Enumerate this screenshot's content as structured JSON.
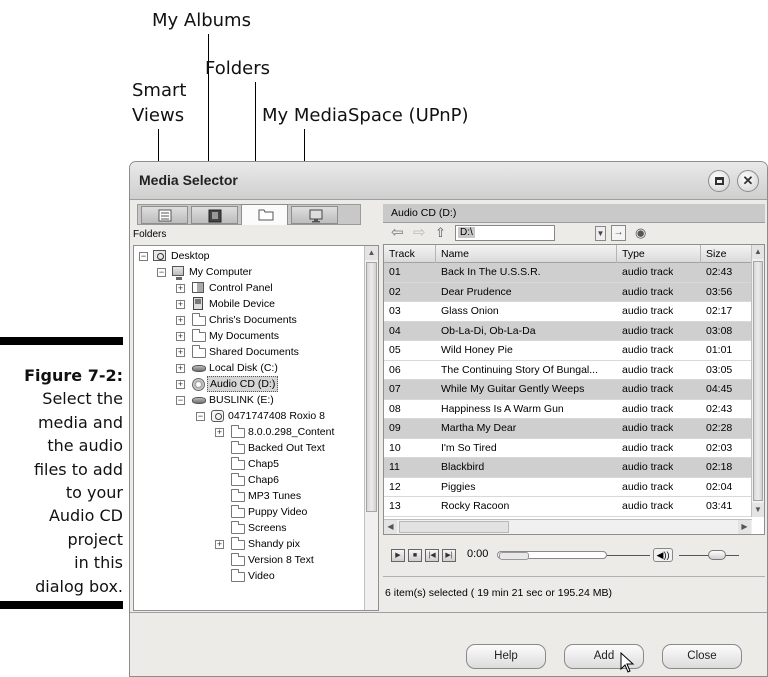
{
  "callouts": {
    "my_albums": "My Albums",
    "folders": "Folders",
    "smart_views_1": "Smart",
    "smart_views_2": "Views",
    "media_space": "My MediaSpace (UPnP)"
  },
  "figure": {
    "label": "Figure 7-2:",
    "lines": [
      "Select the",
      "media and",
      "the audio",
      "files to add",
      "to your",
      "Audio CD",
      "project",
      "in this",
      "dialog box."
    ]
  },
  "dialog": {
    "title": "Media Selector",
    "tabs": [
      "smart-views-icon",
      "my-albums-icon",
      "folders-icon",
      "my-mediaspace-icon"
    ],
    "tree_label": "Folders",
    "tree": {
      "desktop": "Desktop",
      "my_computer": "My Computer",
      "control_panel": "Control Panel",
      "mobile_device": "Mobile Device",
      "chris_docs": "Chris's Documents",
      "my_docs": "My Documents",
      "shared_docs": "Shared Documents",
      "local_disk": "Local Disk (C:)",
      "audio_cd": "Audio CD (D:)",
      "buslink": "BUSLINK (E:)",
      "roxio": "0471747408 Roxio 8",
      "content": "8.0.0.298_Content",
      "backed_out": "Backed Out Text",
      "chap5": "Chap5",
      "chap6": "Chap6",
      "mp3": "MP3 Tunes",
      "puppy": "Puppy Video",
      "screens": "Screens",
      "shandy": "Shandy pix",
      "version8": "Version 8 Text",
      "video": "Video"
    },
    "right_header": "Audio CD (D:)",
    "path_value": "D:\\",
    "columns": {
      "track": "Track",
      "name": "Name",
      "type": "Type",
      "size": "Size"
    },
    "rows": [
      {
        "track": "01",
        "name": "Back In The U.S.S.R.",
        "type": "audio track",
        "size": "02:43"
      },
      {
        "track": "02",
        "name": "Dear Prudence",
        "type": "audio track",
        "size": "03:56"
      },
      {
        "track": "03",
        "name": "Glass Onion",
        "type": "audio track",
        "size": "02:17"
      },
      {
        "track": "04",
        "name": "Ob-La-Di, Ob-La-Da",
        "type": "audio track",
        "size": "03:08"
      },
      {
        "track": "05",
        "name": "Wild Honey Pie",
        "type": "audio track",
        "size": "01:01"
      },
      {
        "track": "06",
        "name": "The Continuing Story Of Bungal...",
        "type": "audio track",
        "size": "03:05"
      },
      {
        "track": "07",
        "name": "While My Guitar Gently Weeps",
        "type": "audio track",
        "size": "04:45"
      },
      {
        "track": "08",
        "name": "Happiness Is A Warm Gun",
        "type": "audio track",
        "size": "02:43"
      },
      {
        "track": "09",
        "name": "Martha My Dear",
        "type": "audio track",
        "size": "02:28"
      },
      {
        "track": "10",
        "name": "I'm So Tired",
        "type": "audio track",
        "size": "02:03"
      },
      {
        "track": "11",
        "name": "Blackbird",
        "type": "audio track",
        "size": "02:18"
      },
      {
        "track": "12",
        "name": "Piggies",
        "type": "audio track",
        "size": "02:04"
      },
      {
        "track": "13",
        "name": "Rocky Racoon",
        "type": "audio track",
        "size": "03:41"
      }
    ],
    "player_time": "0:00",
    "status": "6 item(s) selected  ( 19 min 21 sec or 195.24 MB)",
    "buttons": {
      "help": "Help",
      "add": "Add",
      "close": "Close"
    }
  }
}
